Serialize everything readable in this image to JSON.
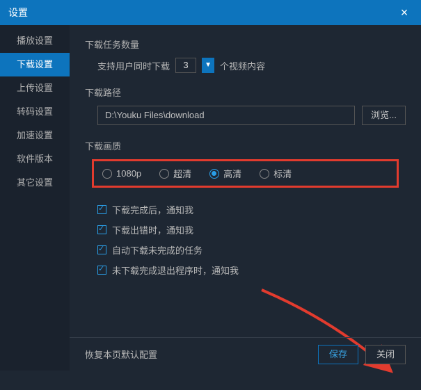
{
  "titlebar": {
    "title": "设置",
    "close_glyph": "×"
  },
  "sidebar": {
    "items": [
      {
        "label": "播放设置"
      },
      {
        "label": "下载设置"
      },
      {
        "label": "上传设置"
      },
      {
        "label": "转码设置"
      },
      {
        "label": "加速设置"
      },
      {
        "label": "软件版本"
      },
      {
        "label": "其它设置"
      }
    ],
    "active_index": 1
  },
  "download_count": {
    "section_label": "下载任务数量",
    "prefix": "支持用户同时下载",
    "value": "3",
    "suffix": "个视频内容",
    "arrow_glyph": "▼"
  },
  "download_path": {
    "section_label": "下载路径",
    "value": "D:\\Youku Files\\download",
    "browse_label": "浏览..."
  },
  "quality": {
    "section_label": "下载画质",
    "options": [
      {
        "label": "1080p"
      },
      {
        "label": "超清"
      },
      {
        "label": "高清"
      },
      {
        "label": "标清"
      }
    ],
    "selected_index": 2
  },
  "checks": [
    {
      "label": "下载完成后，通知我",
      "checked": true
    },
    {
      "label": "下载出错时，通知我",
      "checked": true
    },
    {
      "label": "自动下载未完成的任务",
      "checked": true
    },
    {
      "label": "未下载完成退出程序时，通知我",
      "checked": true
    }
  ],
  "footer": {
    "restore_label": "恢复本页默认配置",
    "save_label": "保存",
    "close_label": "关闭"
  }
}
